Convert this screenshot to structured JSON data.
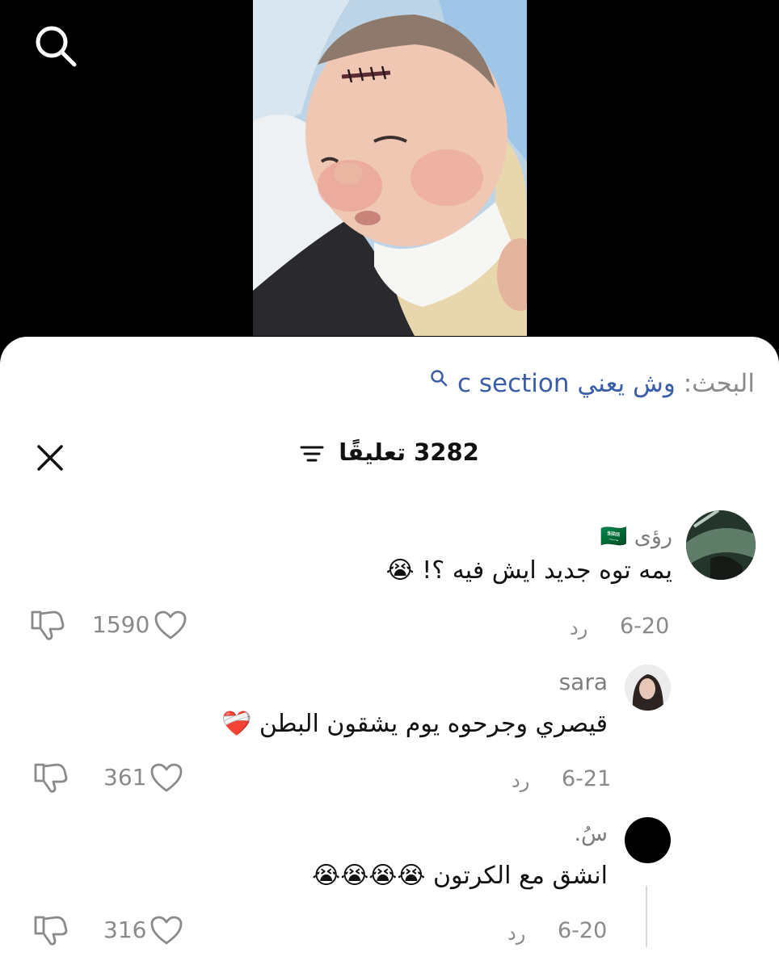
{
  "search_prefix": "البحث:",
  "search_query": "وش يعني c section",
  "comments_title": "3282 تعليقًا",
  "comments": [
    {
      "author": "رؤى",
      "author_flag": "🇸🇦",
      "text": "يمه توه جديد ايش فيه ؟!",
      "emoji": "😭",
      "date": "6-20",
      "reply": "رد",
      "likes": "1590"
    },
    {
      "author": "sara",
      "text": "قيصري وجرحوه يوم يشقون البطن",
      "emoji": "❤️‍🩹",
      "date": "6-21",
      "reply": "رد",
      "likes": "361"
    },
    {
      "author": "سُ.",
      "text": "انشق مع الكرتون",
      "emoji": "😭😭😭😭",
      "date": "6-20",
      "reply": "رد",
      "likes": "316"
    }
  ],
  "icons": {
    "search": "search-icon",
    "close": "close-icon",
    "filter": "filter-icon",
    "heart": "heart-icon",
    "dislike": "dislike-icon"
  },
  "colors": {
    "link": "#3b5ea8",
    "muted": "#8a8a8a",
    "text": "#111111"
  }
}
